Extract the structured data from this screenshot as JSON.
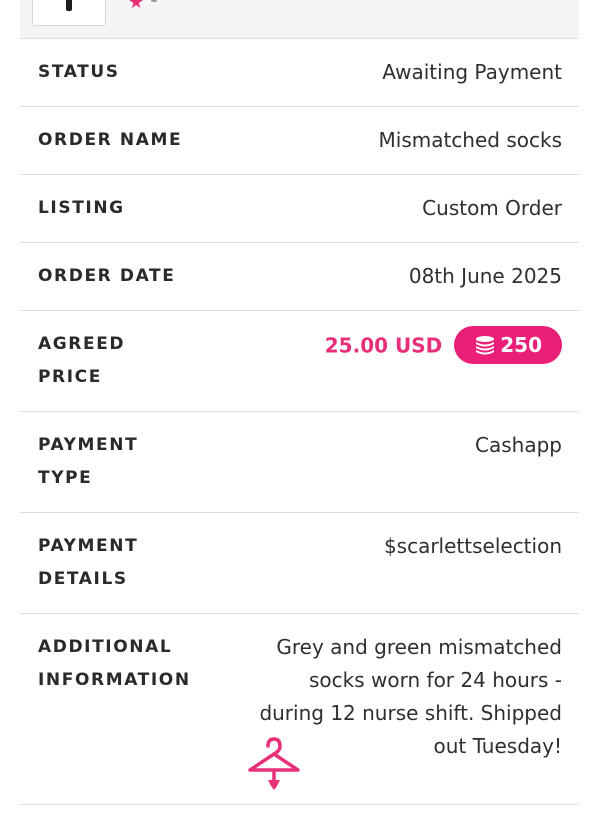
{
  "header": {
    "thumbnail_icon": "product-thumbnail",
    "rating_icon": "star-icon"
  },
  "order": {
    "status_label": "STATUS",
    "status_value": "Awaiting Payment",
    "order_name_label": "ORDER NAME",
    "order_name_value": "Mismatched socks",
    "listing_label": "LISTING",
    "listing_value": "Custom Order",
    "order_date_label": "ORDER DATE",
    "order_date_value": "08th June 2025",
    "agreed_price_label_1": "AGREED",
    "agreed_price_label_2": "PRICE",
    "agreed_price_value": "25.00 USD",
    "coins_value": "250",
    "payment_type_label_1": "PAYMENT",
    "payment_type_label_2": "TYPE",
    "payment_type_value": "Cashapp",
    "payment_details_label_1": "PAYMENT",
    "payment_details_label_2": "DETAILS",
    "payment_details_value": "$scarlettselection",
    "additional_label_1": "ADDITIONAL",
    "additional_label_2": "INFORMATION",
    "additional_line_1": "Grey and green mismatched",
    "additional_line_2": "socks worn for 24 hours -",
    "additional_line_3": "during 12 nurse shift. Shipped",
    "additional_line_4": "out Tuesday!"
  },
  "colors": {
    "accent": "#e8307a",
    "badge": "#ea1f7a",
    "divider": "#dcdcdc"
  },
  "icons": {
    "coin": "coins-stack-icon",
    "hanger": "hanger-icon"
  }
}
